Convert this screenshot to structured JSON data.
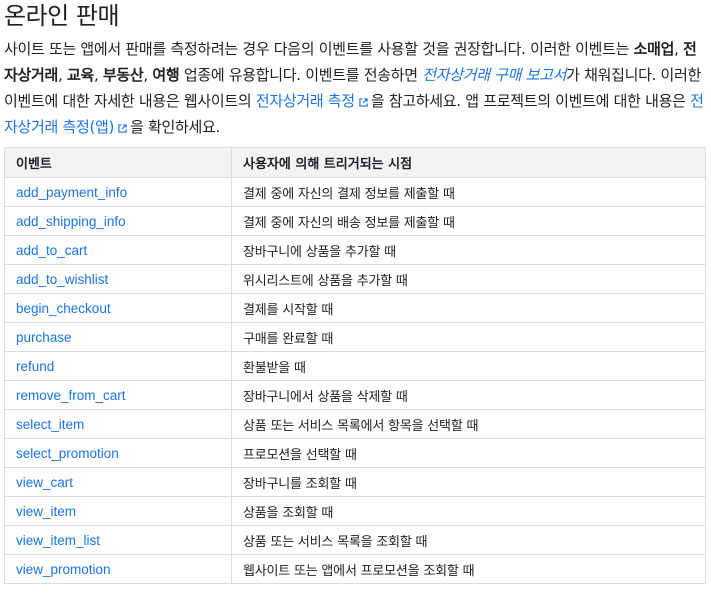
{
  "title": "온라인 판매",
  "intro": {
    "s1": "사이트 또는 앱에서 판매를 측정하려는 경우 다음의 이벤트를 사용할 것을 권장합니다. 이러한 이벤트는 ",
    "b1": "소매업",
    "c1": ", ",
    "b2": "전자상거래",
    "c2": ", ",
    "b3": "교육",
    "c3": ", ",
    "b4": "부동산",
    "c4": ", ",
    "b5": "여행",
    "s2": " 업종에 유용합니다. 이벤트를 전송하면 ",
    "link1": "전자상거래 구매 보고서",
    "s3": "가 채워집니다. 이러한 이벤트에 대한 자세한 내용은 웹사이트의 ",
    "link2": "전자상거래 측정",
    "s4": "을 참고하세요. 앱 프로젝트의 이벤트에 대한 내용은 ",
    "link3": "전자상거래 측정(앱)",
    "s5": "을 확인하세요."
  },
  "table": {
    "headers": [
      "이벤트",
      "사용자에 의해 트리거되는 시점"
    ],
    "rows": [
      {
        "event": "add_payment_info",
        "when": "결제 중에 자신의 결제 정보를 제출할 때"
      },
      {
        "event": "add_shipping_info",
        "when": "결제 중에 자신의 배송 정보를 제출할 때"
      },
      {
        "event": "add_to_cart",
        "when": "장바구니에 상품을 추가할 때"
      },
      {
        "event": "add_to_wishlist",
        "when": "위시리스트에 상품을 추가할 때"
      },
      {
        "event": "begin_checkout",
        "when": "결제를 시작할 때"
      },
      {
        "event": "purchase",
        "when": "구매를 완료할 때"
      },
      {
        "event": "refund",
        "when": "환불받을 때"
      },
      {
        "event": "remove_from_cart",
        "when": "장바구니에서 상품을 삭제할 때"
      },
      {
        "event": "select_item",
        "when": "상품 또는 서비스 목록에서 항목을 선택할 때"
      },
      {
        "event": "select_promotion",
        "when": "프로모션을 선택할 때"
      },
      {
        "event": "view_cart",
        "when": "장바구니를 조회할 때"
      },
      {
        "event": "view_item",
        "when": "상품을 조회할 때"
      },
      {
        "event": "view_item_list",
        "when": "상품 또는 서비스 목록을 조회할 때"
      },
      {
        "event": "view_promotion",
        "when": "웹사이트 또는 앱에서 프로모션을 조회할 때"
      }
    ]
  },
  "icons": {
    "external": "external-link-icon"
  },
  "colors": {
    "link": "#1a73e8",
    "text": "#202124",
    "header_bg": "#f1f3f4",
    "border": "#dadce0"
  }
}
